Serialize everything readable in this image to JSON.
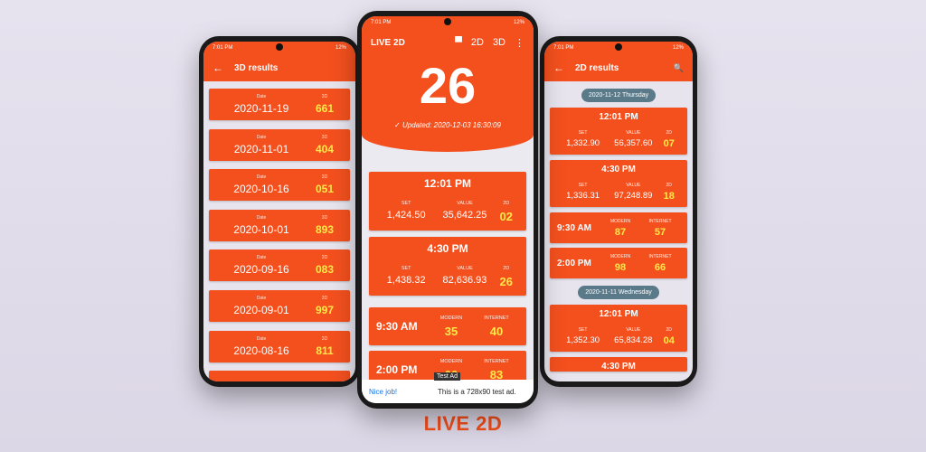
{
  "left": {
    "status": {
      "time": "7:01 PM",
      "right": "12%"
    },
    "appbar_title": "3D results",
    "date_label": "Date",
    "num_label": "3D",
    "items": [
      {
        "date": "2020-11-19",
        "value": "661"
      },
      {
        "date": "2020-11-01",
        "value": "404"
      },
      {
        "date": "2020-10-16",
        "value": "051"
      },
      {
        "date": "2020-10-01",
        "value": "893"
      },
      {
        "date": "2020-09-16",
        "value": "083"
      },
      {
        "date": "2020-09-01",
        "value": "997"
      },
      {
        "date": "2020-08-16",
        "value": "811"
      },
      {
        "date": "",
        "value": ""
      }
    ]
  },
  "center": {
    "status": {
      "time": "7:01 PM",
      "right": "12%"
    },
    "title": "LIVE 2D",
    "action_2d": "2D",
    "action_3d": "3D",
    "big_number": "26",
    "updated": "Updated: 2020-12-03 16:30:09",
    "labels": {
      "set": "SET",
      "value": "VALUE",
      "twod": "2D",
      "modern": "MODERN",
      "internet": "INTERNET"
    },
    "results": [
      {
        "time": "12:01 PM",
        "set": "1,424.50",
        "value": "35,642.25",
        "twod": "02"
      },
      {
        "time": "4:30 PM",
        "set": "1,438.32",
        "value": "82,636.93",
        "twod": "26"
      }
    ],
    "modern": [
      {
        "time": "9:30 AM",
        "modern": "35",
        "internet": "40"
      },
      {
        "time": "2:00 PM",
        "modern": "00",
        "internet": "83"
      }
    ],
    "ad": {
      "badge": "Test Ad",
      "ok": "Nice job!",
      "text": "This is a 728x90 test ad."
    }
  },
  "right": {
    "status": {
      "time": "7:01 PM",
      "right": "12%"
    },
    "appbar_title": "2D results",
    "day1": {
      "date": "2020-11-12 Thursday",
      "results": [
        {
          "time": "12:01 PM",
          "set": "1,332.90",
          "value": "56,357.60",
          "twod": "07"
        },
        {
          "time": "4:30 PM",
          "set": "1,336.31",
          "value": "97,248.89",
          "twod": "18"
        }
      ],
      "modern": [
        {
          "time": "9:30 AM",
          "modern": "87",
          "internet": "57"
        },
        {
          "time": "2:00 PM",
          "modern": "98",
          "internet": "66"
        }
      ]
    },
    "day2": {
      "date": "2020-11-11 Wednesday",
      "results": [
        {
          "time": "12:01 PM",
          "set": "1,352.30",
          "value": "65,834.28",
          "twod": "04"
        },
        {
          "time": "4:30 PM",
          "set": "",
          "value": "",
          "twod": ""
        }
      ]
    }
  },
  "brand": "LIVE 2D",
  "colors": {
    "accent": "#f3501e",
    "number": "#ffe84a",
    "pill": "#5a7a8a"
  }
}
